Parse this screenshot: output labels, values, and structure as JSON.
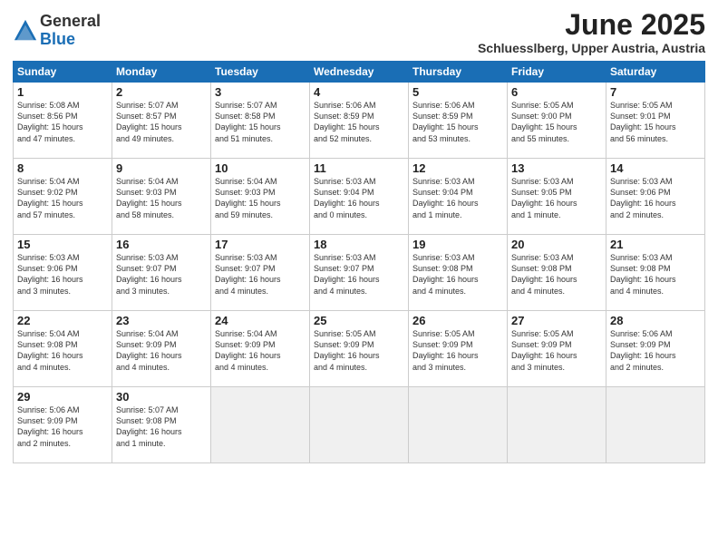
{
  "logo": {
    "general": "General",
    "blue": "Blue"
  },
  "title": "June 2025",
  "subtitle": "Schluesslberg, Upper Austria, Austria",
  "weekdays": [
    "Sunday",
    "Monday",
    "Tuesday",
    "Wednesday",
    "Thursday",
    "Friday",
    "Saturday"
  ],
  "weeks": [
    [
      {
        "day": "1",
        "info": "Sunrise: 5:08 AM\nSunset: 8:56 PM\nDaylight: 15 hours\nand 47 minutes."
      },
      {
        "day": "2",
        "info": "Sunrise: 5:07 AM\nSunset: 8:57 PM\nDaylight: 15 hours\nand 49 minutes."
      },
      {
        "day": "3",
        "info": "Sunrise: 5:07 AM\nSunset: 8:58 PM\nDaylight: 15 hours\nand 51 minutes."
      },
      {
        "day": "4",
        "info": "Sunrise: 5:06 AM\nSunset: 8:59 PM\nDaylight: 15 hours\nand 52 minutes."
      },
      {
        "day": "5",
        "info": "Sunrise: 5:06 AM\nSunset: 8:59 PM\nDaylight: 15 hours\nand 53 minutes."
      },
      {
        "day": "6",
        "info": "Sunrise: 5:05 AM\nSunset: 9:00 PM\nDaylight: 15 hours\nand 55 minutes."
      },
      {
        "day": "7",
        "info": "Sunrise: 5:05 AM\nSunset: 9:01 PM\nDaylight: 15 hours\nand 56 minutes."
      }
    ],
    [
      {
        "day": "8",
        "info": "Sunrise: 5:04 AM\nSunset: 9:02 PM\nDaylight: 15 hours\nand 57 minutes."
      },
      {
        "day": "9",
        "info": "Sunrise: 5:04 AM\nSunset: 9:03 PM\nDaylight: 15 hours\nand 58 minutes."
      },
      {
        "day": "10",
        "info": "Sunrise: 5:04 AM\nSunset: 9:03 PM\nDaylight: 15 hours\nand 59 minutes."
      },
      {
        "day": "11",
        "info": "Sunrise: 5:03 AM\nSunset: 9:04 PM\nDaylight: 16 hours\nand 0 minutes."
      },
      {
        "day": "12",
        "info": "Sunrise: 5:03 AM\nSunset: 9:04 PM\nDaylight: 16 hours\nand 1 minute."
      },
      {
        "day": "13",
        "info": "Sunrise: 5:03 AM\nSunset: 9:05 PM\nDaylight: 16 hours\nand 1 minute."
      },
      {
        "day": "14",
        "info": "Sunrise: 5:03 AM\nSunset: 9:06 PM\nDaylight: 16 hours\nand 2 minutes."
      }
    ],
    [
      {
        "day": "15",
        "info": "Sunrise: 5:03 AM\nSunset: 9:06 PM\nDaylight: 16 hours\nand 3 minutes."
      },
      {
        "day": "16",
        "info": "Sunrise: 5:03 AM\nSunset: 9:07 PM\nDaylight: 16 hours\nand 3 minutes."
      },
      {
        "day": "17",
        "info": "Sunrise: 5:03 AM\nSunset: 9:07 PM\nDaylight: 16 hours\nand 4 minutes."
      },
      {
        "day": "18",
        "info": "Sunrise: 5:03 AM\nSunset: 9:07 PM\nDaylight: 16 hours\nand 4 minutes."
      },
      {
        "day": "19",
        "info": "Sunrise: 5:03 AM\nSunset: 9:08 PM\nDaylight: 16 hours\nand 4 minutes."
      },
      {
        "day": "20",
        "info": "Sunrise: 5:03 AM\nSunset: 9:08 PM\nDaylight: 16 hours\nand 4 minutes."
      },
      {
        "day": "21",
        "info": "Sunrise: 5:03 AM\nSunset: 9:08 PM\nDaylight: 16 hours\nand 4 minutes."
      }
    ],
    [
      {
        "day": "22",
        "info": "Sunrise: 5:04 AM\nSunset: 9:08 PM\nDaylight: 16 hours\nand 4 minutes."
      },
      {
        "day": "23",
        "info": "Sunrise: 5:04 AM\nSunset: 9:09 PM\nDaylight: 16 hours\nand 4 minutes."
      },
      {
        "day": "24",
        "info": "Sunrise: 5:04 AM\nSunset: 9:09 PM\nDaylight: 16 hours\nand 4 minutes."
      },
      {
        "day": "25",
        "info": "Sunrise: 5:05 AM\nSunset: 9:09 PM\nDaylight: 16 hours\nand 4 minutes."
      },
      {
        "day": "26",
        "info": "Sunrise: 5:05 AM\nSunset: 9:09 PM\nDaylight: 16 hours\nand 3 minutes."
      },
      {
        "day": "27",
        "info": "Sunrise: 5:05 AM\nSunset: 9:09 PM\nDaylight: 16 hours\nand 3 minutes."
      },
      {
        "day": "28",
        "info": "Sunrise: 5:06 AM\nSunset: 9:09 PM\nDaylight: 16 hours\nand 2 minutes."
      }
    ],
    [
      {
        "day": "29",
        "info": "Sunrise: 5:06 AM\nSunset: 9:09 PM\nDaylight: 16 hours\nand 2 minutes."
      },
      {
        "day": "30",
        "info": "Sunrise: 5:07 AM\nSunset: 9:08 PM\nDaylight: 16 hours\nand 1 minute."
      },
      {
        "day": "",
        "info": ""
      },
      {
        "day": "",
        "info": ""
      },
      {
        "day": "",
        "info": ""
      },
      {
        "day": "",
        "info": ""
      },
      {
        "day": "",
        "info": ""
      }
    ]
  ]
}
